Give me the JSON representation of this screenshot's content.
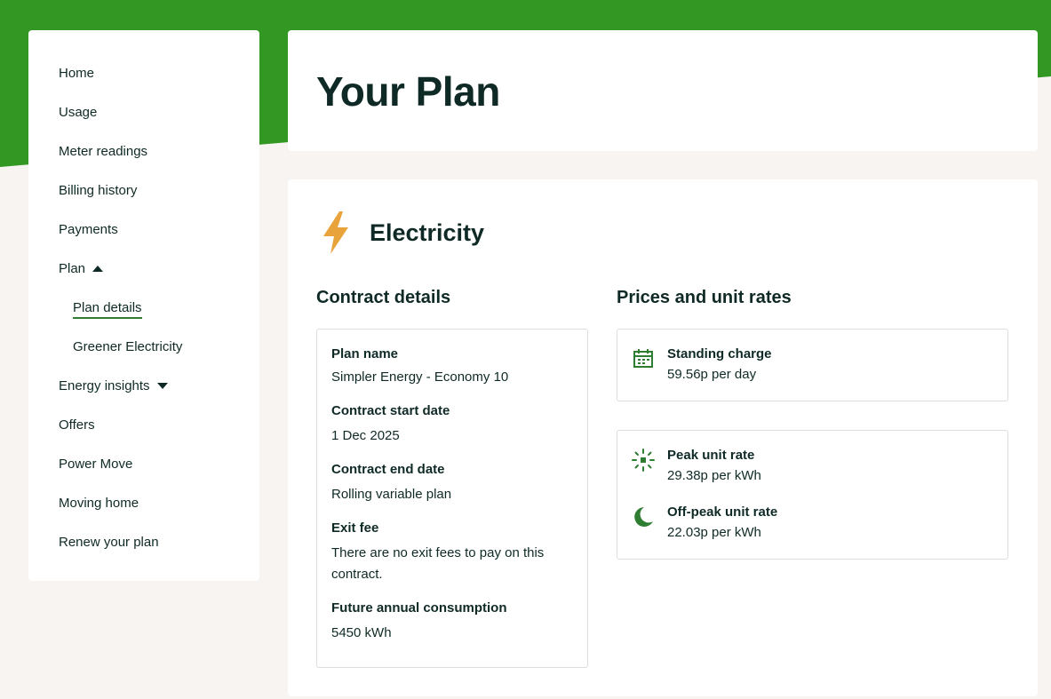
{
  "sidebar": {
    "items": [
      {
        "label": "Home"
      },
      {
        "label": "Usage"
      },
      {
        "label": "Meter readings"
      },
      {
        "label": "Billing history"
      },
      {
        "label": "Payments"
      },
      {
        "label": "Plan"
      },
      {
        "label": "Plan details"
      },
      {
        "label": "Greener Electricity"
      },
      {
        "label": "Energy insights"
      },
      {
        "label": "Offers"
      },
      {
        "label": "Power Move"
      },
      {
        "label": "Moving home"
      },
      {
        "label": "Renew your plan"
      }
    ]
  },
  "page": {
    "title": "Your Plan"
  },
  "electricity": {
    "heading": "Electricity",
    "contract_title": "Contract details",
    "prices_title": "Prices and unit rates",
    "contract": [
      {
        "label": "Plan name",
        "value": "Simpler Energy - Economy 10"
      },
      {
        "label": "Contract start date",
        "value": "1 Dec 2025"
      },
      {
        "label": "Contract end date",
        "value": "Rolling variable plan"
      },
      {
        "label": "Exit fee",
        "value": "There are no exit fees to pay on this contract."
      },
      {
        "label": "Future annual consumption",
        "value": "5450 kWh"
      }
    ],
    "standing_charge": {
      "label": "Standing charge",
      "value": "59.56p per day",
      "icon": "calendar-icon"
    },
    "peak": {
      "label": "Peak unit rate",
      "value": "29.38p per kWh",
      "icon": "sun-icon"
    },
    "offpeak": {
      "label": "Off-peak unit rate",
      "value": "22.03p per kWh",
      "icon": "moon-icon"
    }
  },
  "colors": {
    "brand_green": "#329823",
    "icon_green": "#2e7d32",
    "bolt_amber": "#e8a33a",
    "text_dark": "#0f2a26",
    "page_bg": "#f8f4f1"
  }
}
